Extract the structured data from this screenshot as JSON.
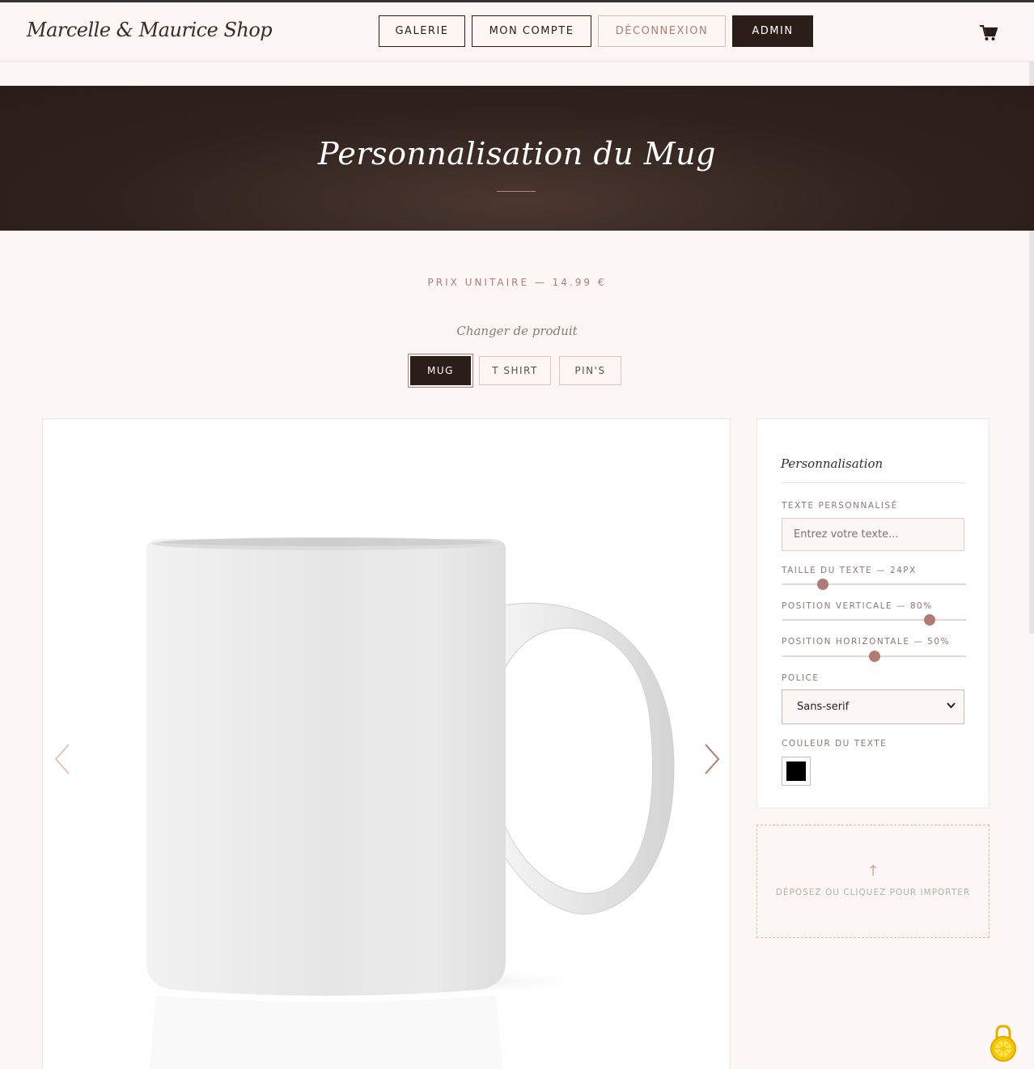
{
  "header": {
    "brand": "Marcelle & Maurice Shop",
    "nav": [
      {
        "label": "GALERIE"
      },
      {
        "label": "MON COMPTE"
      },
      {
        "label": "DÉCONNEXION"
      },
      {
        "label": "ADMIN"
      }
    ],
    "cart_icon": "cart-icon"
  },
  "hero": {
    "title": "Personnalisation du Mug"
  },
  "product": {
    "price_line": "PRIX UNITAIRE — 14.99 €",
    "change_label": "Changer de produit",
    "tabs": [
      {
        "label": "MUG",
        "active": true
      },
      {
        "label": "T SHIRT",
        "active": false
      },
      {
        "label": "PIN'S",
        "active": false
      }
    ]
  },
  "preview": {
    "image": "white-mug",
    "prev_icon": "chevron-left-icon",
    "next_icon": "chevron-right-icon"
  },
  "panel": {
    "title": "Personnalisation",
    "text_label": "TEXTE PERSONNALISÉ",
    "text_placeholder": "Entrez votre texte...",
    "size_label": "TAILLE DU TEXTE — 24PX",
    "size_value": 24,
    "size_fraction": 0.22,
    "vertical_label": "POSITION VERTICALE — 80%",
    "vertical_value": 80,
    "horizontal_label": "POSITION HORIZONTALE — 50%",
    "horizontal_value": 50,
    "font_label": "POLICE",
    "font_value": "Sans-serif",
    "color_label": "COULEUR DU TEXTE",
    "color_value": "#000000"
  },
  "dropzone": {
    "icon": "upload-arrow-icon",
    "text": "DÉPOSEZ OU CLIQUEZ POUR IMPORTER"
  },
  "colors": {
    "accent": "#b07b73",
    "dark": "#2b1d18",
    "background": "#fcf7f5"
  }
}
